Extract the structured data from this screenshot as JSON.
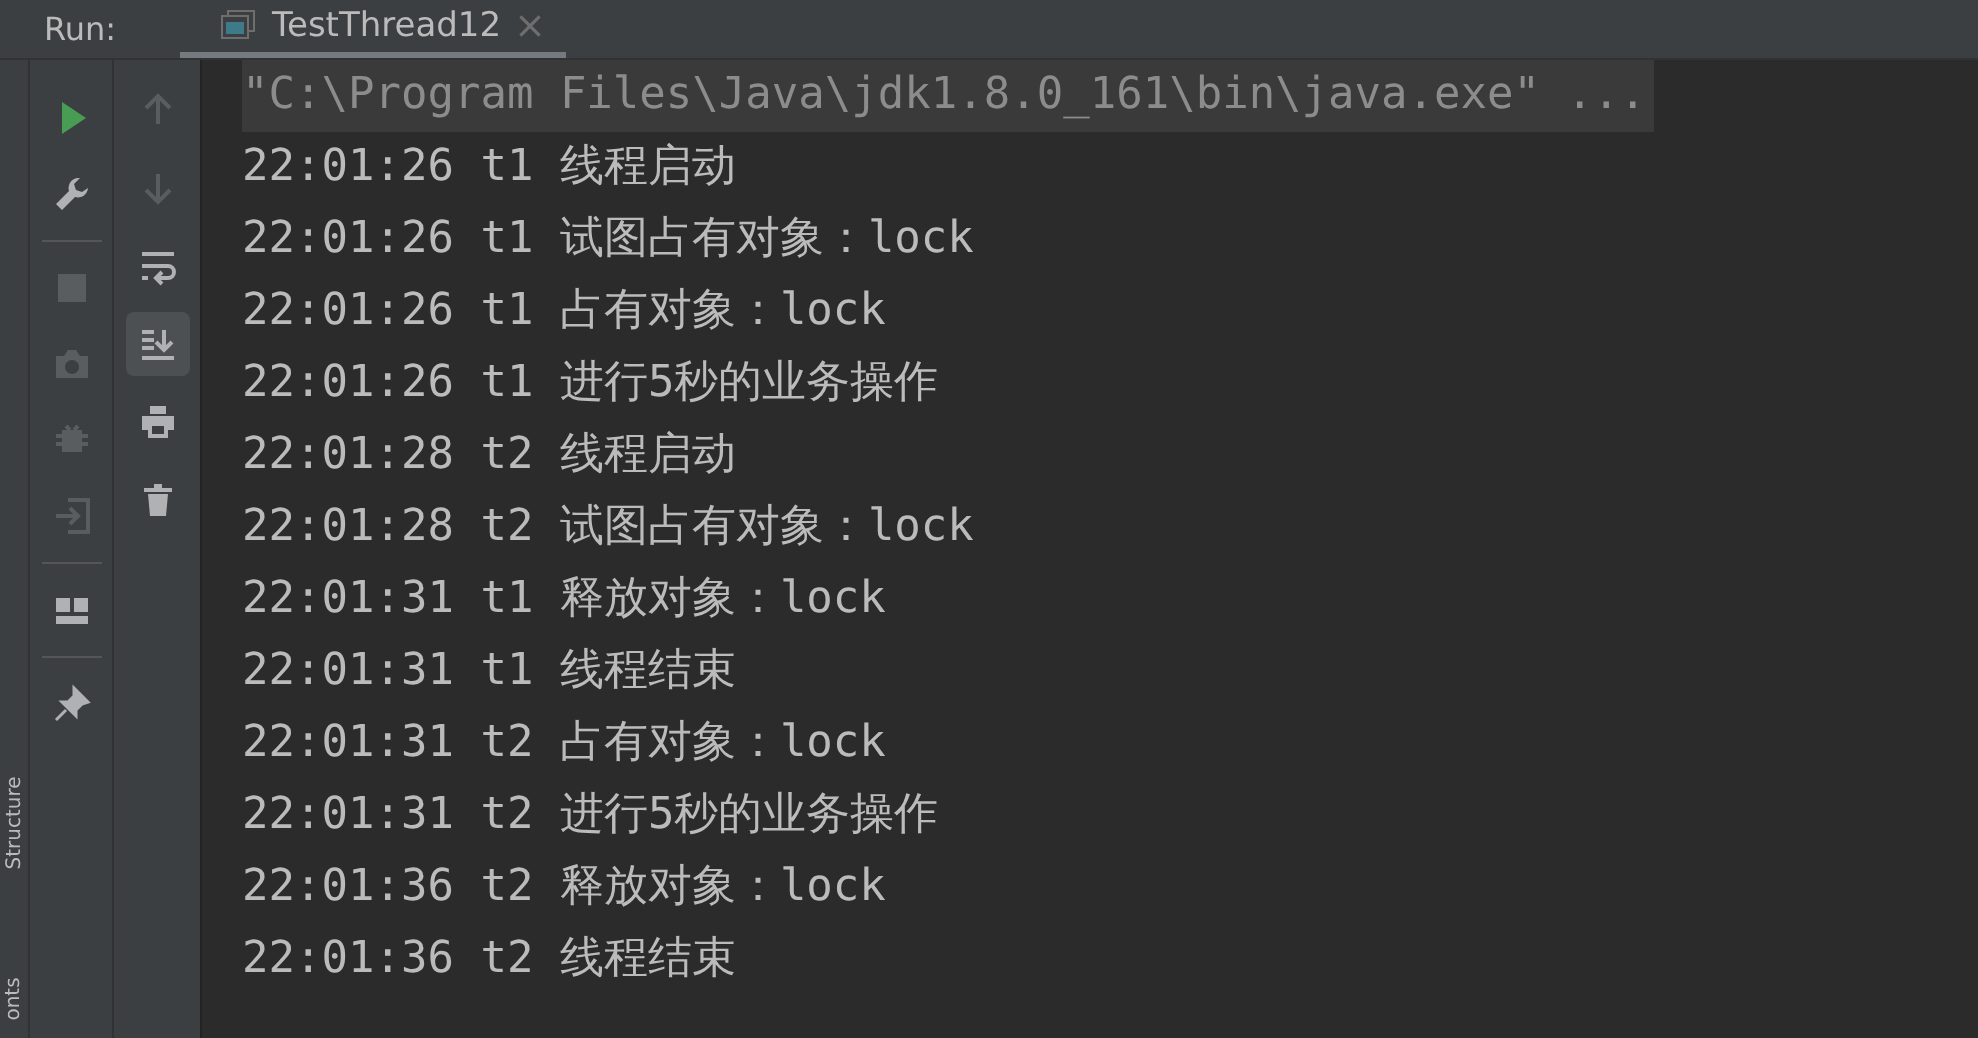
{
  "header": {
    "label": "Run:",
    "tab": {
      "title": "TestThread12",
      "selected": true
    }
  },
  "side_labels": [
    "Structure",
    "onts"
  ],
  "left_toolbar": [
    {
      "kind": "run",
      "disabled": false
    },
    {
      "kind": "wrench",
      "disabled": false
    },
    {
      "kind": "divider"
    },
    {
      "kind": "stop",
      "disabled": true
    },
    {
      "kind": "camera",
      "disabled": true
    },
    {
      "kind": "bug",
      "disabled": true
    },
    {
      "kind": "exit",
      "disabled": true
    },
    {
      "kind": "divider"
    },
    {
      "kind": "layout",
      "disabled": false
    },
    {
      "kind": "divider"
    },
    {
      "kind": "pin",
      "disabled": false
    }
  ],
  "right_toolbar": [
    {
      "kind": "up",
      "disabled": true,
      "selected": false
    },
    {
      "kind": "down",
      "disabled": true,
      "selected": false
    },
    {
      "kind": "wrap",
      "disabled": false,
      "selected": false
    },
    {
      "kind": "scroll-end",
      "disabled": false,
      "selected": true
    },
    {
      "kind": "print",
      "disabled": false,
      "selected": false
    },
    {
      "kind": "trash",
      "disabled": false,
      "selected": false
    }
  ],
  "console": {
    "command": {
      "text": "\"C:\\Program Files\\Java\\jdk1.8.0_161\\bin\\java.exe\" ...",
      "highlighted": true
    },
    "lines": [
      "22:01:26 t1 线程启动",
      "22:01:26 t1 试图占有对象：lock",
      "22:01:26 t1 占有对象：lock",
      "22:01:26 t1 进行5秒的业务操作",
      "22:01:28 t2 线程启动",
      "22:01:28 t2 试图占有对象：lock",
      "22:01:31 t1 释放对象：lock",
      "22:01:31 t1 线程结束",
      "22:01:31 t2 占有对象：lock",
      "22:01:31 t2 进行5秒的业务操作",
      "22:01:36 t2 释放对象：lock",
      "22:01:36 t2 线程结束"
    ]
  }
}
